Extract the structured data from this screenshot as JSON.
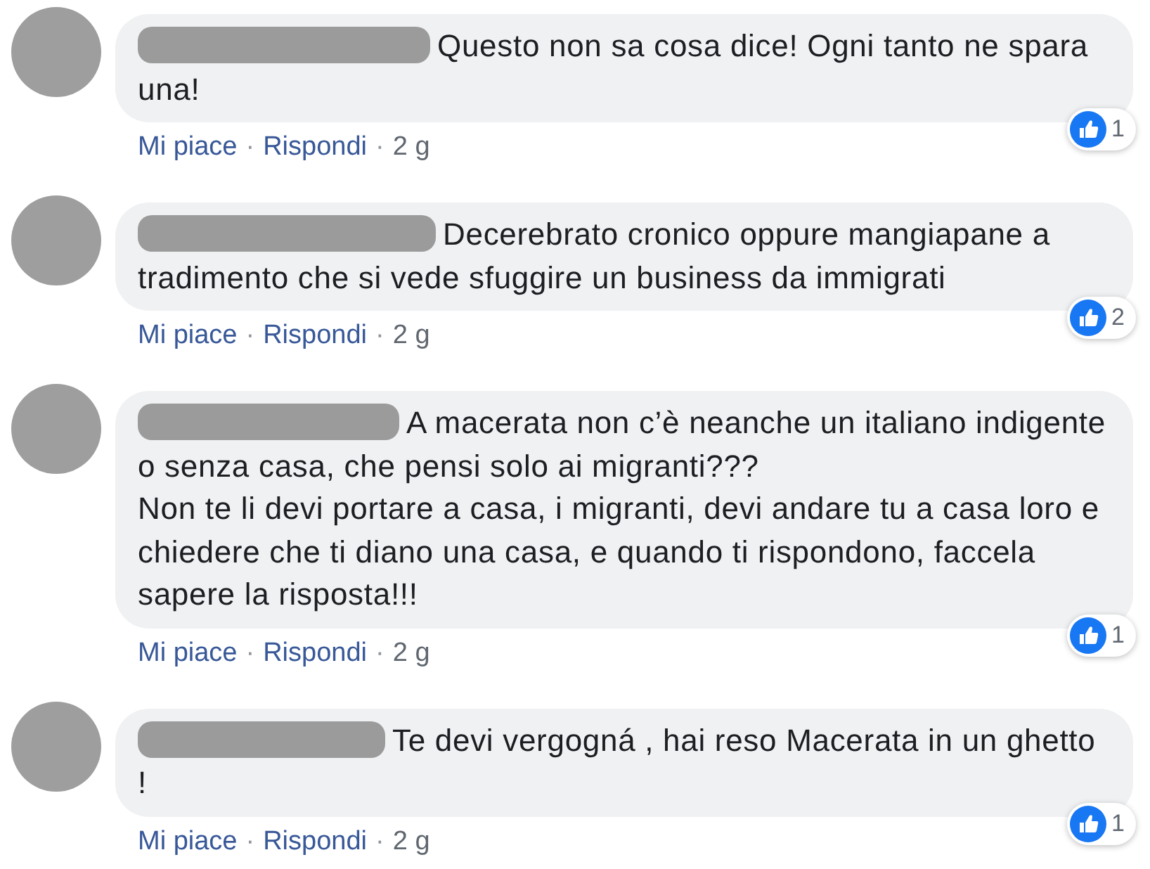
{
  "comments": [
    {
      "text": "Questo non sa cosa dice! Ogni tanto ne spara una!",
      "reactions": "1",
      "actions": {
        "like": "Mi piace",
        "separator_1": "·",
        "reply": "Rispondi",
        "separator_2": "·",
        "time": "2 g"
      }
    },
    {
      "text": "Decerebrato cronico oppure mangiapane a tradimento che si vede sfuggire un business da immigrati",
      "reactions": "2",
      "actions": {
        "like": "Mi piace",
        "separator_1": "·",
        "reply": "Rispondi",
        "separator_2": "·",
        "time": "2 g"
      }
    },
    {
      "text": "A macerata non c’è neanche un italiano indigente o senza casa, che pensi solo ai migranti???\nNon te li devi portare a casa, i migranti, devi andare tu a casa loro e chiedere che ti diano una casa, e quando ti rispondono, faccela sapere la risposta!!!",
      "reactions": "1",
      "actions": {
        "like": "Mi piace",
        "separator_1": "·",
        "reply": "Rispondi",
        "separator_2": "·",
        "time": "2 g"
      }
    },
    {
      "text": "Te devi vergogná , hai reso Macerata in un ghetto !",
      "reactions": "1",
      "actions": {
        "like": "Mi piace",
        "separator_1": "·",
        "reply": "Rispondi",
        "separator_2": "·",
        "time": "2 g"
      }
    }
  ]
}
